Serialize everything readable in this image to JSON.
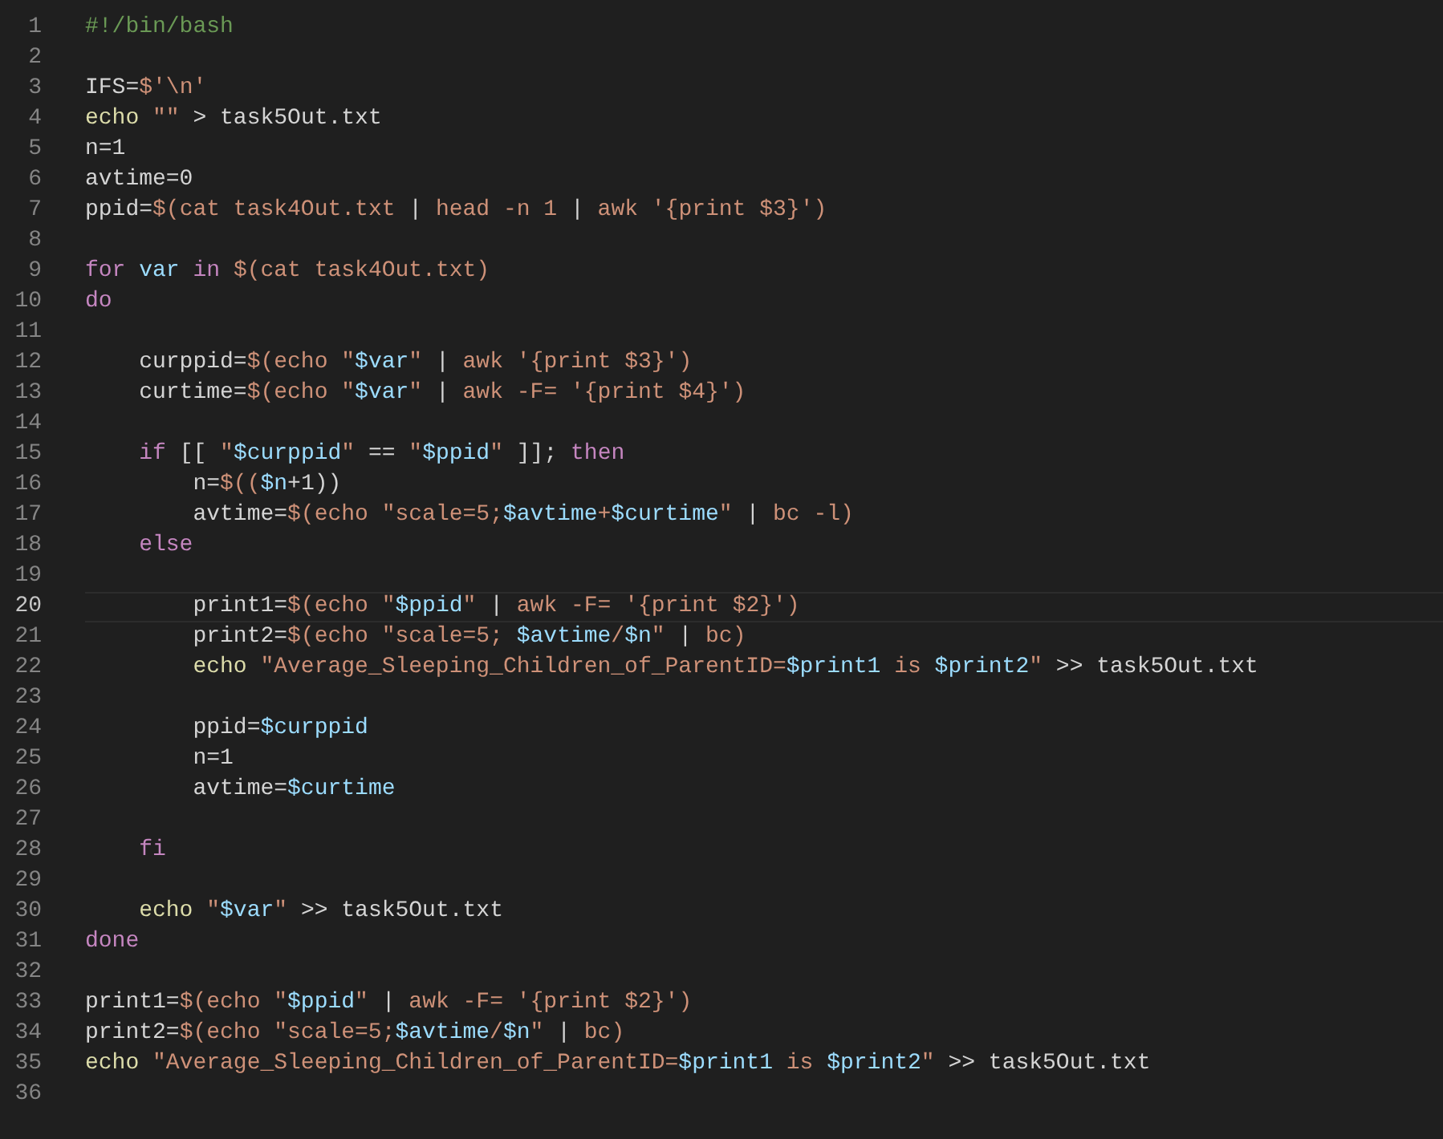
{
  "editor": {
    "lines": [
      {
        "number": "1",
        "current": false,
        "tokens": [
          {
            "kind": "comment",
            "text": "#!/bin/bash"
          }
        ]
      },
      {
        "number": "2",
        "current": false
      },
      {
        "number": "3",
        "current": false,
        "tokens": [
          {
            "kind": "plain",
            "text": "IFS="
          },
          {
            "kind": "string",
            "text": "$'\\n'"
          }
        ]
      },
      {
        "number": "4",
        "current": false,
        "tokens": [
          {
            "kind": "command",
            "text": "echo "
          },
          {
            "kind": "string",
            "text": "\"\""
          },
          {
            "kind": "plain",
            "text": " > task5Out.txt"
          }
        ]
      },
      {
        "number": "5",
        "current": false,
        "tokens": [
          {
            "kind": "plain",
            "text": "n=1"
          }
        ]
      },
      {
        "number": "6",
        "current": false,
        "tokens": [
          {
            "kind": "plain",
            "text": "avtime=0"
          }
        ]
      },
      {
        "number": "7",
        "current": false,
        "tokens": [
          {
            "kind": "plain",
            "text": "ppid="
          },
          {
            "kind": "string",
            "text": "$(cat task4Out.txt "
          },
          {
            "kind": "plain",
            "text": "| "
          },
          {
            "kind": "string",
            "text": "head -n 1 "
          },
          {
            "kind": "plain",
            "text": "| "
          },
          {
            "kind": "string",
            "text": "awk '{print $3}')"
          }
        ]
      },
      {
        "number": "8",
        "current": false
      },
      {
        "number": "9",
        "current": false,
        "tokens": [
          {
            "kind": "keyword",
            "text": "for "
          },
          {
            "kind": "variable",
            "text": "var "
          },
          {
            "kind": "keyword",
            "text": "in "
          },
          {
            "kind": "string",
            "text": "$(cat task4Out.txt)"
          }
        ]
      },
      {
        "number": "10",
        "current": false,
        "tokens": [
          {
            "kind": "keyword",
            "text": "do"
          }
        ]
      },
      {
        "number": "11",
        "current": false
      },
      {
        "number": "12",
        "current": false,
        "tokens": [
          {
            "kind": "plain",
            "text": "    curppid="
          },
          {
            "kind": "string",
            "text": "$(echo \""
          },
          {
            "kind": "variable",
            "text": "$var"
          },
          {
            "kind": "string",
            "text": "\" "
          },
          {
            "kind": "plain",
            "text": "| "
          },
          {
            "kind": "string",
            "text": "awk '{print $3}')"
          }
        ]
      },
      {
        "number": "13",
        "current": false,
        "tokens": [
          {
            "kind": "plain",
            "text": "    curtime="
          },
          {
            "kind": "string",
            "text": "$(echo \""
          },
          {
            "kind": "variable",
            "text": "$var"
          },
          {
            "kind": "string",
            "text": "\" "
          },
          {
            "kind": "plain",
            "text": "| "
          },
          {
            "kind": "string",
            "text": "awk -F= '{print $4}')"
          }
        ]
      },
      {
        "number": "14",
        "current": false
      },
      {
        "number": "15",
        "current": false,
        "tokens": [
          {
            "kind": "keyword",
            "text": "    if"
          },
          {
            "kind": "plain",
            "text": " [[ "
          },
          {
            "kind": "string",
            "text": "\""
          },
          {
            "kind": "variable",
            "text": "$curppid"
          },
          {
            "kind": "string",
            "text": "\""
          },
          {
            "kind": "plain",
            "text": " == "
          },
          {
            "kind": "string",
            "text": "\""
          },
          {
            "kind": "variable",
            "text": "$ppid"
          },
          {
            "kind": "string",
            "text": "\""
          },
          {
            "kind": "plain",
            "text": " ]]; "
          },
          {
            "kind": "keyword",
            "text": "then"
          }
        ]
      },
      {
        "number": "16",
        "current": false,
        "tokens": [
          {
            "kind": "plain",
            "text": "        n="
          },
          {
            "kind": "string",
            "text": "$(("
          },
          {
            "kind": "variable",
            "text": "$n"
          },
          {
            "kind": "plain",
            "text": "+1))"
          }
        ]
      },
      {
        "number": "17",
        "current": false,
        "tokens": [
          {
            "kind": "plain",
            "text": "        avtime="
          },
          {
            "kind": "string",
            "text": "$(echo \"scale=5;"
          },
          {
            "kind": "variable",
            "text": "$avtime"
          },
          {
            "kind": "string",
            "text": "+"
          },
          {
            "kind": "variable",
            "text": "$curtime"
          },
          {
            "kind": "string",
            "text": "\" "
          },
          {
            "kind": "plain",
            "text": "| "
          },
          {
            "kind": "string",
            "text": "bc -l)"
          }
        ]
      },
      {
        "number": "18",
        "current": false,
        "tokens": [
          {
            "kind": "keyword",
            "text": "    else"
          }
        ]
      },
      {
        "number": "19",
        "current": false
      },
      {
        "number": "20",
        "current": true,
        "tokens": [
          {
            "kind": "plain",
            "text": "        print1="
          },
          {
            "kind": "string",
            "text": "$(echo \""
          },
          {
            "kind": "variable",
            "text": "$ppid"
          },
          {
            "kind": "string",
            "text": "\" "
          },
          {
            "kind": "plain",
            "text": "| "
          },
          {
            "kind": "string",
            "text": "awk -F= '{print $2}')"
          }
        ]
      },
      {
        "number": "21",
        "current": false,
        "tokens": [
          {
            "kind": "plain",
            "text": "        print2="
          },
          {
            "kind": "string",
            "text": "$(echo \"scale=5; "
          },
          {
            "kind": "variable",
            "text": "$avtime"
          },
          {
            "kind": "string",
            "text": "/"
          },
          {
            "kind": "variable",
            "text": "$n"
          },
          {
            "kind": "string",
            "text": "\" "
          },
          {
            "kind": "plain",
            "text": "| "
          },
          {
            "kind": "string",
            "text": "bc)"
          }
        ]
      },
      {
        "number": "22",
        "current": false,
        "tokens": [
          {
            "kind": "command",
            "text": "        echo "
          },
          {
            "kind": "string",
            "text": "\"Average_Sleeping_Children_of_ParentID="
          },
          {
            "kind": "variable",
            "text": "$print1"
          },
          {
            "kind": "string",
            "text": " is "
          },
          {
            "kind": "variable",
            "text": "$print2"
          },
          {
            "kind": "string",
            "text": "\""
          },
          {
            "kind": "plain",
            "text": " >> task5Out.txt"
          }
        ]
      },
      {
        "number": "23",
        "current": false
      },
      {
        "number": "24",
        "current": false,
        "tokens": [
          {
            "kind": "plain",
            "text": "        ppid="
          },
          {
            "kind": "variable",
            "text": "$curppid"
          }
        ]
      },
      {
        "number": "25",
        "current": false,
        "tokens": [
          {
            "kind": "plain",
            "text": "        n=1"
          }
        ]
      },
      {
        "number": "26",
        "current": false,
        "tokens": [
          {
            "kind": "plain",
            "text": "        avtime="
          },
          {
            "kind": "variable",
            "text": "$curtime"
          }
        ]
      },
      {
        "number": "27",
        "current": false
      },
      {
        "number": "28",
        "current": false,
        "tokens": [
          {
            "kind": "keyword",
            "text": "    fi"
          }
        ]
      },
      {
        "number": "29",
        "current": false
      },
      {
        "number": "30",
        "current": false,
        "tokens": [
          {
            "kind": "command",
            "text": "    echo "
          },
          {
            "kind": "string",
            "text": "\""
          },
          {
            "kind": "variable",
            "text": "$var"
          },
          {
            "kind": "string",
            "text": "\""
          },
          {
            "kind": "plain",
            "text": " >> task5Out.txt"
          }
        ]
      },
      {
        "number": "31",
        "current": false,
        "tokens": [
          {
            "kind": "keyword",
            "text": "done"
          }
        ]
      },
      {
        "number": "32",
        "current": false
      },
      {
        "number": "33",
        "current": false,
        "tokens": [
          {
            "kind": "plain",
            "text": "print1="
          },
          {
            "kind": "string",
            "text": "$(echo \""
          },
          {
            "kind": "variable",
            "text": "$ppid"
          },
          {
            "kind": "string",
            "text": "\" "
          },
          {
            "kind": "plain",
            "text": "| "
          },
          {
            "kind": "string",
            "text": "awk -F= '{print $2}')"
          }
        ]
      },
      {
        "number": "34",
        "current": false,
        "tokens": [
          {
            "kind": "plain",
            "text": "print2="
          },
          {
            "kind": "string",
            "text": "$(echo \"scale=5;"
          },
          {
            "kind": "variable",
            "text": "$avtime"
          },
          {
            "kind": "string",
            "text": "/"
          },
          {
            "kind": "variable",
            "text": "$n"
          },
          {
            "kind": "string",
            "text": "\" "
          },
          {
            "kind": "plain",
            "text": "| "
          },
          {
            "kind": "string",
            "text": "bc)"
          }
        ]
      },
      {
        "number": "35",
        "current": false,
        "tokens": [
          {
            "kind": "command",
            "text": "echo "
          },
          {
            "kind": "string",
            "text": "\"Average_Sleeping_Children_of_ParentID="
          },
          {
            "kind": "variable",
            "text": "$print1"
          },
          {
            "kind": "string",
            "text": " is "
          },
          {
            "kind": "variable",
            "text": "$print2"
          },
          {
            "kind": "string",
            "text": "\""
          },
          {
            "kind": "plain",
            "text": " >> task5Out.txt"
          }
        ]
      },
      {
        "number": "36",
        "current": false
      }
    ]
  }
}
